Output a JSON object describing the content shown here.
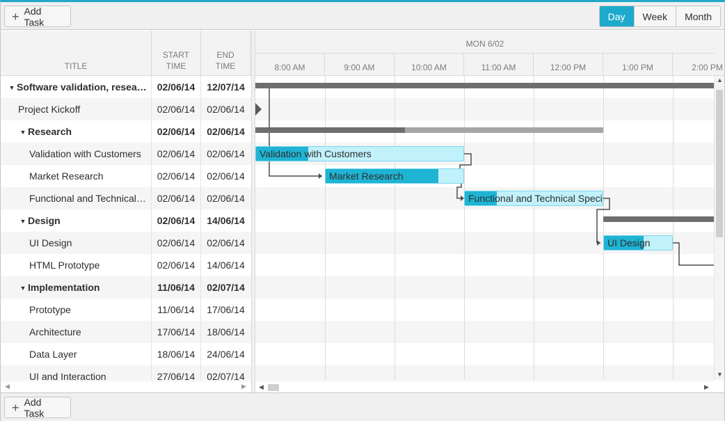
{
  "toolbar": {
    "add_task_label": "Add Task",
    "views": [
      {
        "label": "Day",
        "active": true
      },
      {
        "label": "Week",
        "active": false
      },
      {
        "label": "Month",
        "active": false
      }
    ]
  },
  "grid": {
    "columns": {
      "title": "TITLE",
      "start": [
        "START",
        "TIME"
      ],
      "end": [
        "END",
        "TIME"
      ]
    },
    "rows": [
      {
        "title": "Software validation, research and implementation",
        "start": "02/06/14",
        "end": "12/07/14",
        "summary": true,
        "level": 0,
        "expanded": true
      },
      {
        "title": "Project Kickoff",
        "start": "02/06/14",
        "end": "02/06/14",
        "summary": false,
        "level": 1
      },
      {
        "title": "Research",
        "start": "02/06/14",
        "end": "02/06/14",
        "summary": true,
        "level": 1,
        "expanded": true
      },
      {
        "title": "Validation with Customers",
        "start": "02/06/14",
        "end": "02/06/14",
        "summary": false,
        "level": 2
      },
      {
        "title": "Market Research",
        "start": "02/06/14",
        "end": "02/06/14",
        "summary": false,
        "level": 2
      },
      {
        "title": "Functional and Technical Specification",
        "start": "02/06/14",
        "end": "02/06/14",
        "summary": false,
        "level": 2
      },
      {
        "title": "Design",
        "start": "02/06/14",
        "end": "14/06/14",
        "summary": true,
        "level": 1,
        "expanded": true
      },
      {
        "title": "UI Design",
        "start": "02/06/14",
        "end": "02/06/14",
        "summary": false,
        "level": 2
      },
      {
        "title": "HTML Prototype",
        "start": "02/06/14",
        "end": "14/06/14",
        "summary": false,
        "level": 2
      },
      {
        "title": "Implementation",
        "start": "11/06/14",
        "end": "02/07/14",
        "summary": true,
        "level": 1,
        "expanded": true
      },
      {
        "title": "Prototype",
        "start": "11/06/14",
        "end": "17/06/14",
        "summary": false,
        "level": 2
      },
      {
        "title": "Architecture",
        "start": "17/06/14",
        "end": "18/06/14",
        "summary": false,
        "level": 2
      },
      {
        "title": "Data Layer",
        "start": "18/06/14",
        "end": "24/06/14",
        "summary": false,
        "level": 2
      },
      {
        "title": "UI and Interaction",
        "start": "27/06/14",
        "end": "02/07/14",
        "summary": false,
        "level": 2
      }
    ]
  },
  "timeline": {
    "day_label": "MON 6/02",
    "hours": [
      "8:00 AM",
      "9:00 AM",
      "10:00 AM",
      "11:00 AM",
      "12:00 PM",
      "1:00 PM",
      "2:00 PM"
    ]
  },
  "bars": [
    {
      "row": 3,
      "label": "Validation with Customers",
      "start": 8.0,
      "end": 11.0,
      "progress": 0.25
    },
    {
      "row": 4,
      "label": "Market Research",
      "start": 9.0,
      "end": 11.0,
      "progress": 0.82
    },
    {
      "row": 5,
      "label": "Functional and Technical Specification",
      "start": 11.0,
      "end": 13.0,
      "progress": 0.23
    },
    {
      "row": 7,
      "label": "UI Design",
      "start": 13.0,
      "end": 14.0,
      "progress": 0.58
    }
  ],
  "summary_bars": [
    {
      "row": 0,
      "start": 8.0,
      "end": 14.6,
      "progress": 1.0
    },
    {
      "row": 2,
      "start": 8.0,
      "end": 13.0,
      "progress": 0.43
    },
    {
      "row": 6,
      "start": 13.0,
      "end": 14.6,
      "progress": 1.0
    }
  ],
  "milestones": [
    {
      "row": 1,
      "time": 8.0
    }
  ],
  "colors": {
    "accent": "#1eaacc",
    "bar_fill": "#c1f1fb",
    "bar_progress": "#1fb4d4",
    "summary": "#6e6e6e",
    "summary_remaining": "#a6a6a6"
  }
}
